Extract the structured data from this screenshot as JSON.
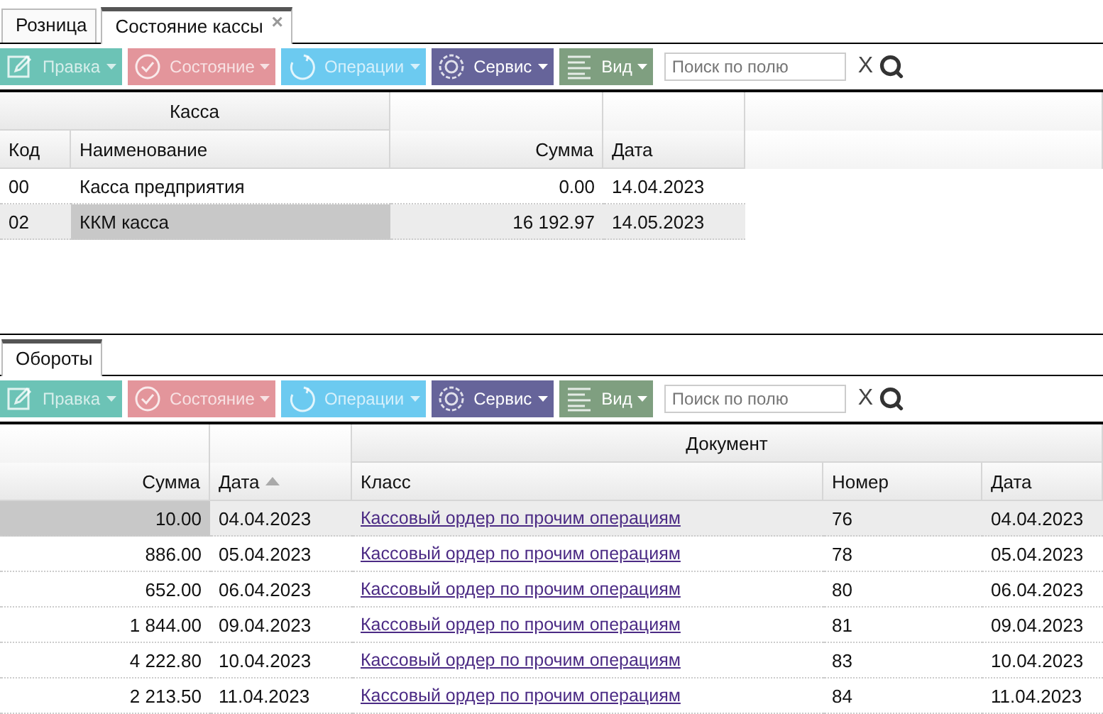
{
  "tabs": [
    {
      "label": "Розница",
      "selected": false
    },
    {
      "label": "Состояние кассы",
      "selected": true,
      "close": "×"
    }
  ],
  "toolbar": {
    "buttons": [
      {
        "label": "Правка",
        "kind": "edit",
        "color": "#6cc3b6",
        "disabled": true
      },
      {
        "label": "Состояние",
        "kind": "state",
        "color": "#e3959b",
        "disabled": true
      },
      {
        "label": "Операции",
        "kind": "operations",
        "color": "#6ccaf0",
        "disabled": true
      },
      {
        "label": "Сервис",
        "kind": "service",
        "color": "#66649a",
        "disabled": false
      },
      {
        "label": "Вид",
        "kind": "view",
        "color": "#7f9f80",
        "disabled": false
      }
    ],
    "search": {
      "placeholder": "Поиск по полю"
    },
    "clear": "X"
  },
  "kassa_table": {
    "group": "Касса",
    "columns": [
      "Код",
      "Наименование",
      "Сумма",
      "Дата"
    ],
    "rows": [
      {
        "cells": [
          "00",
          "Касса предприятия",
          "0.00",
          "14.04.2023"
        ],
        "selected": false
      },
      {
        "cells": [
          "02",
          "ККМ касса",
          "16 192.97",
          "14.05.2023"
        ],
        "selected": true
      }
    ]
  },
  "bottom_tabs": [
    {
      "label": "Обороты",
      "selected": true
    }
  ],
  "bottom_toolbar": {
    "buttons": [
      {
        "label": "Правка",
        "kind": "edit",
        "color": "#6cc3b6",
        "disabled": true
      },
      {
        "label": "Состояние",
        "kind": "state",
        "color": "#e3959b",
        "disabled": true
      },
      {
        "label": "Операции",
        "kind": "operations",
        "color": "#6ccaf0",
        "disabled": true
      },
      {
        "label": "Сервис",
        "kind": "service",
        "color": "#66649a",
        "disabled": false
      },
      {
        "label": "Вид",
        "kind": "view",
        "color": "#7f9f80",
        "disabled": false
      }
    ],
    "search": {
      "placeholder": "Поиск по полю"
    },
    "clear": "X"
  },
  "turnover_table": {
    "group": "Документ",
    "columns": [
      {
        "label": "Сумма",
        "sorted": false
      },
      {
        "label": "Дата",
        "sorted": true
      },
      {
        "label": "Класс",
        "sorted": false
      },
      {
        "label": "Номер",
        "sorted": false
      },
      {
        "label": "Дата",
        "sorted": false
      }
    ],
    "rows": [
      {
        "cells": [
          "10.00",
          "04.04.2023",
          "Кассовый ордер по прочим операциям",
          "76",
          "04.04.2023"
        ],
        "selected": true
      },
      {
        "cells": [
          "886.00",
          "05.04.2023",
          "Кассовый ордер по прочим операциям",
          "78",
          "05.04.2023"
        ],
        "selected": false
      },
      {
        "cells": [
          "652.00",
          "06.04.2023",
          "Кассовый ордер по прочим операциям",
          "80",
          "06.04.2023"
        ],
        "selected": false
      },
      {
        "cells": [
          "1 844.00",
          "09.04.2023",
          "Кассовый ордер по прочим операциям",
          "81",
          "09.04.2023"
        ],
        "selected": false
      },
      {
        "cells": [
          "4 222.80",
          "10.04.2023",
          "Кассовый ордер по прочим операциям",
          "83",
          "10.04.2023"
        ],
        "selected": false
      },
      {
        "cells": [
          "2 213.50",
          "11.04.2023",
          "Кассовый ордер по прочим операциям",
          "84",
          "11.04.2023"
        ],
        "selected": false
      }
    ]
  }
}
